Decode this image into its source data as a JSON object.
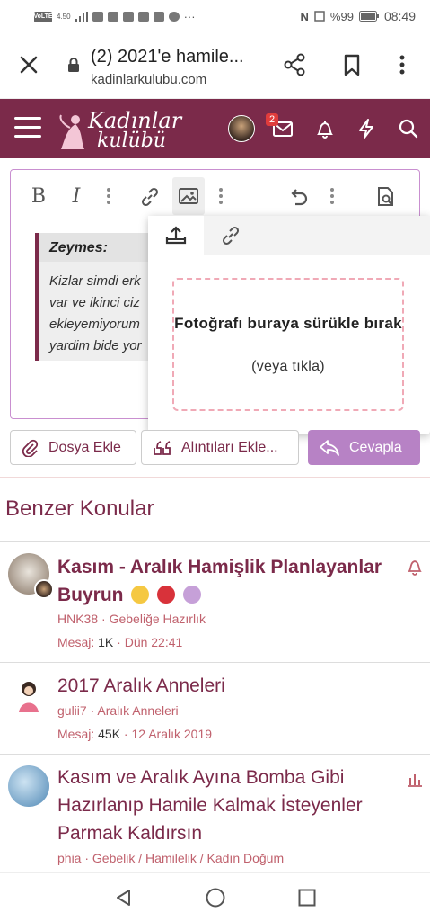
{
  "status": {
    "network_chip": "VoLTE",
    "speed": "4.50",
    "battery": "%99",
    "time": "08:49"
  },
  "browser": {
    "tab_title": "(2) 2021'e hamile...",
    "url": "kadinlarkulubu.com"
  },
  "site": {
    "logo_line1": "Kadınlar",
    "logo_line2": "kulübü",
    "notification_count": "2"
  },
  "editor": {
    "toolbar": {
      "bold": "B",
      "italic": "I"
    },
    "quote": {
      "author": "Zeymes:",
      "lines": [
        "Kizlar simdi erk",
        "var ve ikinci ciz",
        "ekleyemiyorum",
        "yardim bide yor"
      ]
    }
  },
  "image_popup": {
    "drop_text": "Fotoğrafı buraya sürükle bırak",
    "click_text": "(veya tıkla)"
  },
  "actions": {
    "attach": "Dosya Ekle",
    "quotes": "Alıntıları Ekle...",
    "reply": "Cevapla"
  },
  "similar": {
    "title": "Benzer Konular",
    "topics": [
      {
        "title": "Kasım - Aralık Hamişlik Planlayanlar Buyrun",
        "author": "HNK38",
        "forum": "Gebeliğe Hazırlık",
        "messages_label": "Mesaj:",
        "messages": "1K",
        "date": "Dün 22:41"
      },
      {
        "title": "2017 Aralık Anneleri",
        "author": "gulii7",
        "forum": "Aralık Anneleri",
        "messages_label": "Mesaj:",
        "messages": "45K",
        "date": "12 Aralık 2019"
      },
      {
        "title": "Kasım ve Aralık Ayına Bomba Gibi Hazırlanıp Hamile Kalmak İsteyenler Parmak Kaldırsın",
        "author": "phia",
        "forum": "Gebelik / Hamilelik / Kadın Doğum"
      }
    ]
  },
  "colors": {
    "brand": "#7b2a4a",
    "reply_button": "#b782c5",
    "meta_text": "#c0616d"
  }
}
